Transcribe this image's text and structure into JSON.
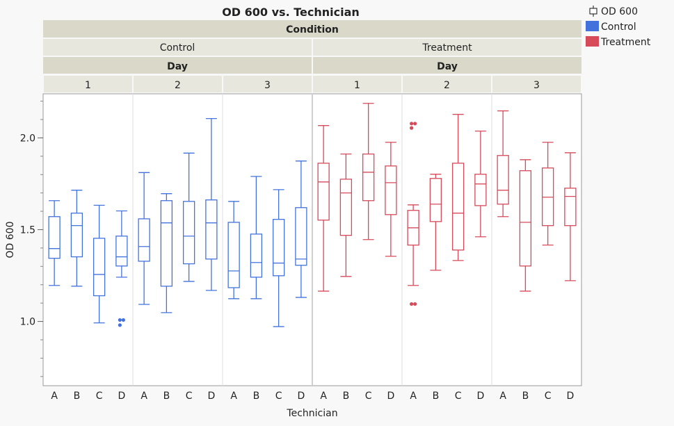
{
  "chart_data": {
    "type": "box",
    "title": "OD 600 vs. Technician",
    "xlabel": "Technician",
    "ylabel": "OD 600",
    "ylim": [
      0.65,
      2.24
    ],
    "yticks": [
      1.0,
      1.5,
      2.0
    ],
    "ytick_labels": [
      "1.0",
      "1.5",
      "2.0"
    ],
    "grid": false,
    "outer_group_label": "Condition",
    "inner_group_label": "Day",
    "legend": {
      "placement": "top-right",
      "title": "OD 600",
      "entries": [
        {
          "name": "Control",
          "color": "#4472dd"
        },
        {
          "name": "Treatment",
          "color": "#d64a5a"
        }
      ]
    },
    "technicians": [
      "A",
      "B",
      "C",
      "D"
    ],
    "conditions": [
      {
        "name": "Control",
        "color": "#4472dd",
        "days": [
          {
            "day": "1",
            "boxes": [
              {
                "tech": "A",
                "min": 1.196,
                "q1": 1.344,
                "median": 1.397,
                "q3": 1.571,
                "max": 1.658,
                "outliers": []
              },
              {
                "tech": "B",
                "min": 1.192,
                "q1": 1.352,
                "median": 1.522,
                "q3": 1.59,
                "max": 1.715,
                "outliers": []
              },
              {
                "tech": "C",
                "min": 0.992,
                "q1": 1.14,
                "median": 1.256,
                "q3": 1.453,
                "max": 1.633,
                "outliers": []
              },
              {
                "tech": "D",
                "min": 1.241,
                "q1": 1.302,
                "median": 1.352,
                "q3": 1.465,
                "max": 1.602,
                "outliers": [
                  1.008,
                  1.008,
                  0.98
                ]
              }
            ]
          },
          {
            "day": "2",
            "boxes": [
              {
                "tech": "A",
                "min": 1.093,
                "q1": 1.328,
                "median": 1.408,
                "q3": 1.559,
                "max": 1.811,
                "outliers": []
              },
              {
                "tech": "B",
                "min": 1.048,
                "q1": 1.192,
                "median": 1.537,
                "q3": 1.658,
                "max": 1.696,
                "outliers": []
              },
              {
                "tech": "C",
                "min": 1.218,
                "q1": 1.314,
                "median": 1.465,
                "q3": 1.654,
                "max": 1.917,
                "outliers": []
              },
              {
                "tech": "D",
                "min": 1.169,
                "q1": 1.34,
                "median": 1.537,
                "q3": 1.662,
                "max": 2.105,
                "outliers": []
              }
            ]
          },
          {
            "day": "3",
            "boxes": [
              {
                "tech": "A",
                "min": 1.124,
                "q1": 1.184,
                "median": 1.275,
                "q3": 1.54,
                "max": 1.654,
                "outliers": []
              },
              {
                "tech": "B",
                "min": 1.124,
                "q1": 1.241,
                "median": 1.321,
                "q3": 1.476,
                "max": 1.79,
                "outliers": []
              },
              {
                "tech": "C",
                "min": 0.972,
                "q1": 1.249,
                "median": 1.318,
                "q3": 1.556,
                "max": 1.718,
                "outliers": []
              },
              {
                "tech": "D",
                "min": 1.131,
                "q1": 1.306,
                "median": 1.34,
                "q3": 1.62,
                "max": 1.874,
                "outliers": []
              }
            ]
          }
        ]
      },
      {
        "name": "Treatment",
        "color": "#d64a5a",
        "days": [
          {
            "day": "1",
            "boxes": [
              {
                "tech": "A",
                "min": 1.165,
                "q1": 1.552,
                "median": 1.76,
                "q3": 1.862,
                "max": 2.067,
                "outliers": []
              },
              {
                "tech": "B",
                "min": 1.245,
                "q1": 1.469,
                "median": 1.7,
                "q3": 1.775,
                "max": 1.912,
                "outliers": []
              },
              {
                "tech": "C",
                "min": 1.446,
                "q1": 1.658,
                "median": 1.813,
                "q3": 1.912,
                "max": 2.188,
                "outliers": []
              },
              {
                "tech": "D",
                "min": 1.355,
                "q1": 1.582,
                "median": 1.756,
                "q3": 1.847,
                "max": 1.976,
                "outliers": []
              }
            ]
          },
          {
            "day": "2",
            "boxes": [
              {
                "tech": "A",
                "min": 1.196,
                "q1": 1.416,
                "median": 1.51,
                "q3": 1.605,
                "max": 1.635,
                "outliers": [
                  2.078,
                  2.078,
                  2.054,
                  1.095,
                  1.095
                ]
              },
              {
                "tech": "B",
                "min": 1.279,
                "q1": 1.544,
                "median": 1.639,
                "q3": 1.779,
                "max": 1.802,
                "outliers": []
              },
              {
                "tech": "C",
                "min": 1.332,
                "q1": 1.389,
                "median": 1.59,
                "q3": 1.862,
                "max": 2.128,
                "outliers": []
              },
              {
                "tech": "D",
                "min": 1.461,
                "q1": 1.631,
                "median": 1.749,
                "q3": 1.802,
                "max": 2.037,
                "outliers": []
              }
            ]
          },
          {
            "day": "3",
            "boxes": [
              {
                "tech": "A",
                "min": 1.571,
                "q1": 1.639,
                "median": 1.715,
                "q3": 1.904,
                "max": 2.147,
                "outliers": []
              },
              {
                "tech": "B",
                "min": 1.165,
                "q1": 1.302,
                "median": 1.54,
                "q3": 1.821,
                "max": 1.881,
                "outliers": []
              },
              {
                "tech": "C",
                "min": 1.416,
                "q1": 1.522,
                "median": 1.677,
                "q3": 1.836,
                "max": 1.976,
                "outliers": []
              },
              {
                "tech": "D",
                "min": 1.222,
                "q1": 1.522,
                "median": 1.681,
                "q3": 1.726,
                "max": 1.919,
                "outliers": []
              }
            ]
          }
        ]
      }
    ]
  }
}
